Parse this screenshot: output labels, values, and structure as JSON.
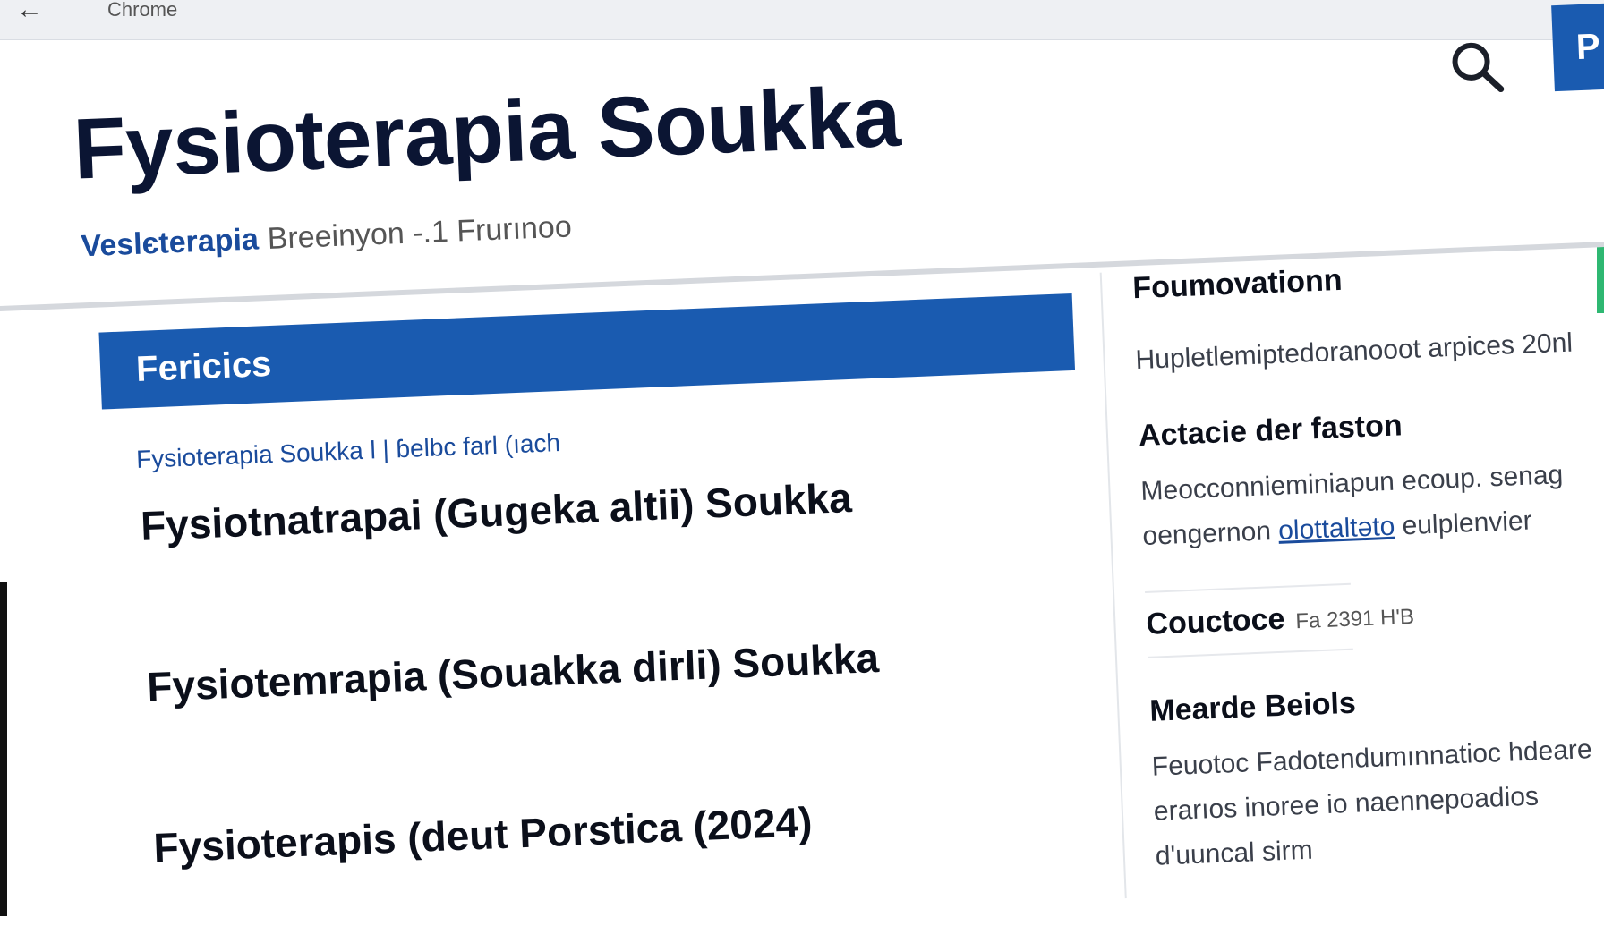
{
  "browser": {
    "url_text": "Chrome"
  },
  "header": {
    "title": "Fysioterapia Soukka",
    "subtitle_accent": "Veslєterapia",
    "subtitle_rest": "Breeinyon -.1 Frurınoo",
    "cta_label": "P"
  },
  "main": {
    "section_title": "Fericics",
    "breadcrumb": "Fysioterapia Soukka l | ɓelbc farl (ıach",
    "results": [
      "Fysiotnatrapai (Gugeka altii) Soukka",
      "Fysiotemrapia (Souakka dirli) Soukka",
      "Fysioterapis (deut Porstica (2024)"
    ]
  },
  "sidebar": {
    "heading": "Foumovationn",
    "intro_text": "Hupletlemiptedoranooot arpices 20nl",
    "subheading_1": "Actacie der faston",
    "text_1_a": "Meocconnieminiapun ecoup. senag oengernon",
    "text_1_link": "olottaltəto",
    "text_1_b": "eulplenvier",
    "contact_label": "Couctoce",
    "contact_value": "Fa 2391 H'B",
    "subheading_2": "Mearde Beiols",
    "text_2": "Feuotoc Fadotendumınnatioc hdeare erarıos inoree io naennepoadios d'uuncal sirm"
  },
  "colors": {
    "accent_blue": "#1a5bb0",
    "title_navy": "#0b1533",
    "link_blue": "#1a4b9c",
    "edge_green": "#2eb872"
  }
}
